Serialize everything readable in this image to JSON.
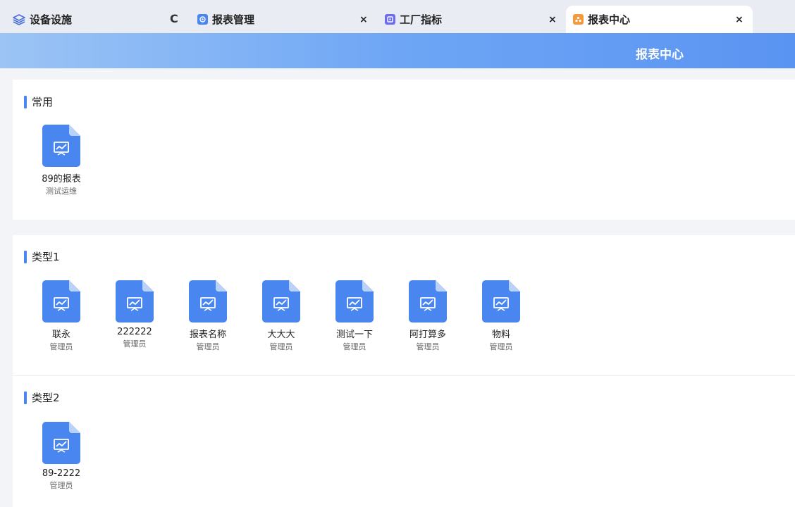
{
  "tabs": {
    "home": {
      "label": "设备设施",
      "icon": "layers-icon"
    },
    "items": [
      {
        "label": "报表管理",
        "icon": "report-manage-icon",
        "icon_color": "#4a86f0"
      },
      {
        "label": "工厂指标",
        "icon": "factory-metric-icon",
        "icon_color": "#6b6cf0"
      },
      {
        "label": "报表中心",
        "icon": "report-center-icon",
        "icon_color": "#f59a3c",
        "active": true
      }
    ],
    "close_glyph": "×",
    "refresh_glyph": "C"
  },
  "header": {
    "title": "报表中心"
  },
  "colors": {
    "accent": "#4a86f0",
    "icon_blue": "#4a86f0",
    "header_end": "#5a94f2"
  },
  "sections": [
    {
      "title": "常用",
      "reports": [
        {
          "name": "89的报表",
          "owner": "测试运维"
        }
      ]
    },
    {
      "title": "类型1",
      "reports": [
        {
          "name": "联永",
          "owner": "管理员"
        },
        {
          "name": "222222",
          "owner": "管理员"
        },
        {
          "name": "报表名称",
          "owner": "管理员"
        },
        {
          "name": "大大大",
          "owner": "管理员"
        },
        {
          "name": "测试一下",
          "owner": "管理员"
        },
        {
          "name": "阿打算多",
          "owner": "管理员"
        },
        {
          "name": "物料",
          "owner": "管理员"
        }
      ]
    },
    {
      "title": "类型2",
      "reports": [
        {
          "name": "89-2222",
          "owner": "管理员"
        }
      ]
    }
  ]
}
